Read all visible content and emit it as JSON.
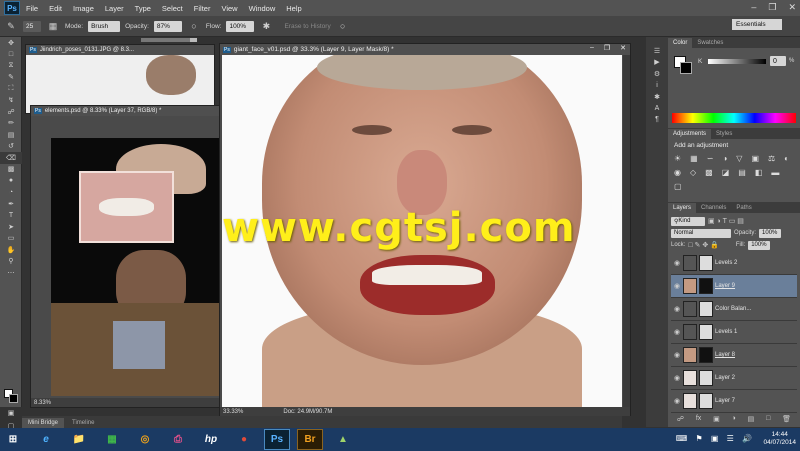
{
  "menubar": {
    "logo": "Ps",
    "items": [
      "File",
      "Edit",
      "Image",
      "Layer",
      "Type",
      "Select",
      "Filter",
      "View",
      "Window",
      "Help"
    ]
  },
  "options": {
    "brush_size": "25",
    "mode_label": "Mode:",
    "mode_value": "Brush",
    "opacity_label": "Opacity:",
    "opacity_value": "87%",
    "flow_label": "Flow:",
    "flow_value": "100%",
    "erase_history": "Erase to History",
    "workspace": "Essentials"
  },
  "docs": {
    "back": {
      "title": "Jiindrich_poses_0131.JPG @ 8.3..."
    },
    "elements": {
      "title": "elements.psd @ 8.33% (Layer 37, RGB/8) *",
      "zoom": "8.33%"
    },
    "main": {
      "title": "giant_face_v01.psd @ 33.3% (Layer 9, Layer Mask/8) *",
      "zoom": "33.33%",
      "doc_size": "Doc: 24.9M/90.7M"
    }
  },
  "watermark": "www.cgtsj.com",
  "minibridge": {
    "tabs": [
      "Mini Bridge",
      "Timeline"
    ]
  },
  "color_panel": {
    "tabs": [
      "Color",
      "Swatches"
    ],
    "channel": "K",
    "value": "0",
    "unit": "%"
  },
  "adjustments_panel": {
    "tabs": [
      "Adjustments",
      "Styles"
    ],
    "heading": "Add an adjustment"
  },
  "layers_panel": {
    "tabs": [
      "Layers",
      "Channels",
      "Paths"
    ],
    "kind": "Kind",
    "blend_mode": "Normal",
    "opacity_label": "Opacity:",
    "opacity_value": "100%",
    "lock_label": "Lock:",
    "fill_label": "Fill:",
    "fill_value": "100%",
    "layers": [
      {
        "name": "Levels 2",
        "thumb": "adj"
      },
      {
        "name": "Layer 9",
        "thumb": "face",
        "selected": true
      },
      {
        "name": "Color Balan...",
        "thumb": "adj"
      },
      {
        "name": "Levels 1",
        "thumb": "adj"
      },
      {
        "name": "Layer 8",
        "thumb": "face"
      },
      {
        "name": "Layer 2",
        "thumb": "adj"
      },
      {
        "name": "Layer 7",
        "thumb": "adj"
      }
    ]
  },
  "taskbar": {
    "apps": [
      "e",
      "📁",
      "▦",
      "◎",
      "⎙",
      "hp",
      "●",
      "Ps",
      "Br",
      "▲"
    ],
    "time": "14:44",
    "date": "04/07/2014"
  },
  "colors": {
    "accent": "#1e5d8e",
    "watermark": "#ffef1a",
    "taskbar": "#1b3a63"
  }
}
